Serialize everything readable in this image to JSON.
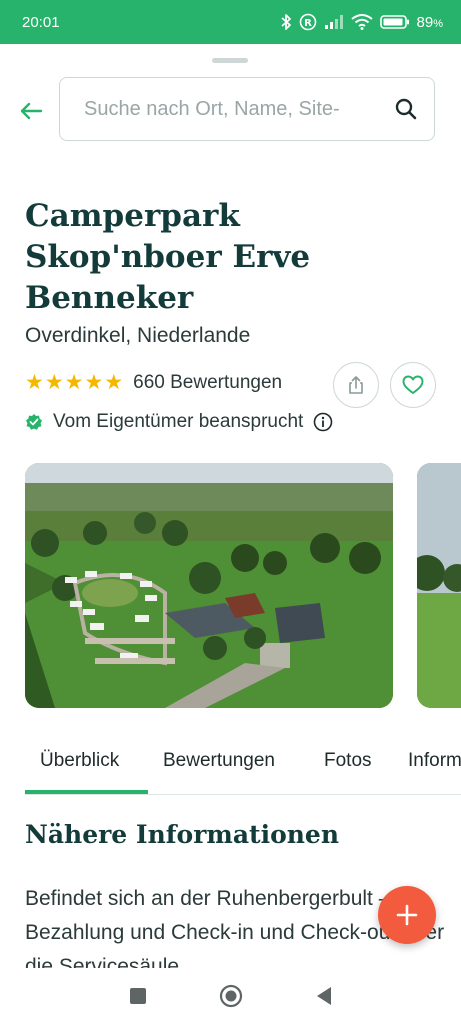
{
  "status_bar": {
    "time": "20:01",
    "battery": "89",
    "battery_unit": "%",
    "icons": [
      "bluetooth-icon",
      "registered-icon",
      "signal-icon",
      "wifi-icon",
      "battery-icon"
    ]
  },
  "search": {
    "placeholder": "Suche nach Ort, Name, Site-"
  },
  "place": {
    "title": "Camperpark Skop'nboer Erve Benneker",
    "location": "Overdinkel, Niederlande",
    "rating_stars": 5,
    "reviews": "660 Bewertungen",
    "claimed": "Vom Eigentümer beansprucht"
  },
  "tabs": [
    {
      "label": "Überblick",
      "active": true
    },
    {
      "label": "Bewertungen",
      "active": false
    },
    {
      "label": "Fotos",
      "active": false
    },
    {
      "label": "Informationen",
      "active": false
    }
  ],
  "section": {
    "title": "Nähere Informationen",
    "text": "Befindet sich an der Ruhenbergerbult – Bezahlung und Check-in und Check-out über die Servicesäule"
  },
  "colors": {
    "brand_green": "#27b36b",
    "title_teal": "#123b3a",
    "star_yellow": "#f5b800",
    "fab_red": "#f25b3e"
  }
}
